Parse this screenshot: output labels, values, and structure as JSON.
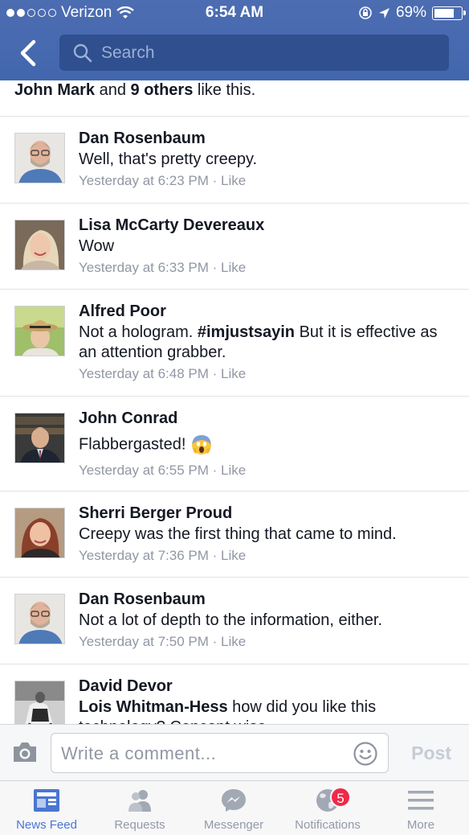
{
  "status_bar": {
    "carrier": "Verizon",
    "time": "6:54 AM",
    "battery": "69%"
  },
  "search": {
    "placeholder": "Search"
  },
  "likes": {
    "name": "John Mark",
    "and": " and ",
    "others": "9 others",
    "suffix": " like this."
  },
  "comments": [
    {
      "name": "Dan Rosenbaum",
      "text": "Well, that's pretty creepy.",
      "time": "Yesterday at 6:23 PM",
      "like": "Like"
    },
    {
      "name": "Lisa McCarty Devereaux",
      "text": "Wow",
      "time": "Yesterday at 6:33 PM",
      "like": "Like"
    },
    {
      "name": "Alfred Poor",
      "text_before": "Not a hologram. ",
      "hashtag": "#imjustsayin",
      "text_after": " But it is effective as an attention grabber.",
      "time": "Yesterday at 6:48 PM",
      "like": "Like"
    },
    {
      "name": "John Conrad",
      "text": "Flabbergasted!",
      "time": "Yesterday at 6:55 PM",
      "like": "Like"
    },
    {
      "name": "Sherri Berger Proud",
      "text": "Creepy was the first thing that came to mind.",
      "time": "Yesterday at 7:36 PM",
      "like": "Like"
    },
    {
      "name": "Dan Rosenbaum",
      "text": "Not a lot of depth to the information, either.",
      "time": "Yesterday at 7:50 PM",
      "like": "Like"
    },
    {
      "name": "David Devor",
      "mention": "Lois Whitman-Hess",
      "text": " how did you like this technology? Concept wise",
      "time": "",
      "like": ""
    }
  ],
  "meta_separator": " · ",
  "composer": {
    "placeholder": "Write a comment...",
    "post_label": "Post"
  },
  "tabs": [
    {
      "label": "News Feed",
      "icon": "news-feed-icon",
      "active": true
    },
    {
      "label": "Requests",
      "icon": "friend-requests-icon",
      "active": false
    },
    {
      "label": "Messenger",
      "icon": "messenger-icon",
      "active": false
    },
    {
      "label": "Notifications",
      "icon": "globe-icon",
      "badge": "5",
      "active": false
    },
    {
      "label": "More",
      "icon": "menu-icon",
      "active": false
    }
  ],
  "colors": {
    "brand": "#4267b2",
    "active_tab": "#4a76d2",
    "badge": "#f02849"
  }
}
